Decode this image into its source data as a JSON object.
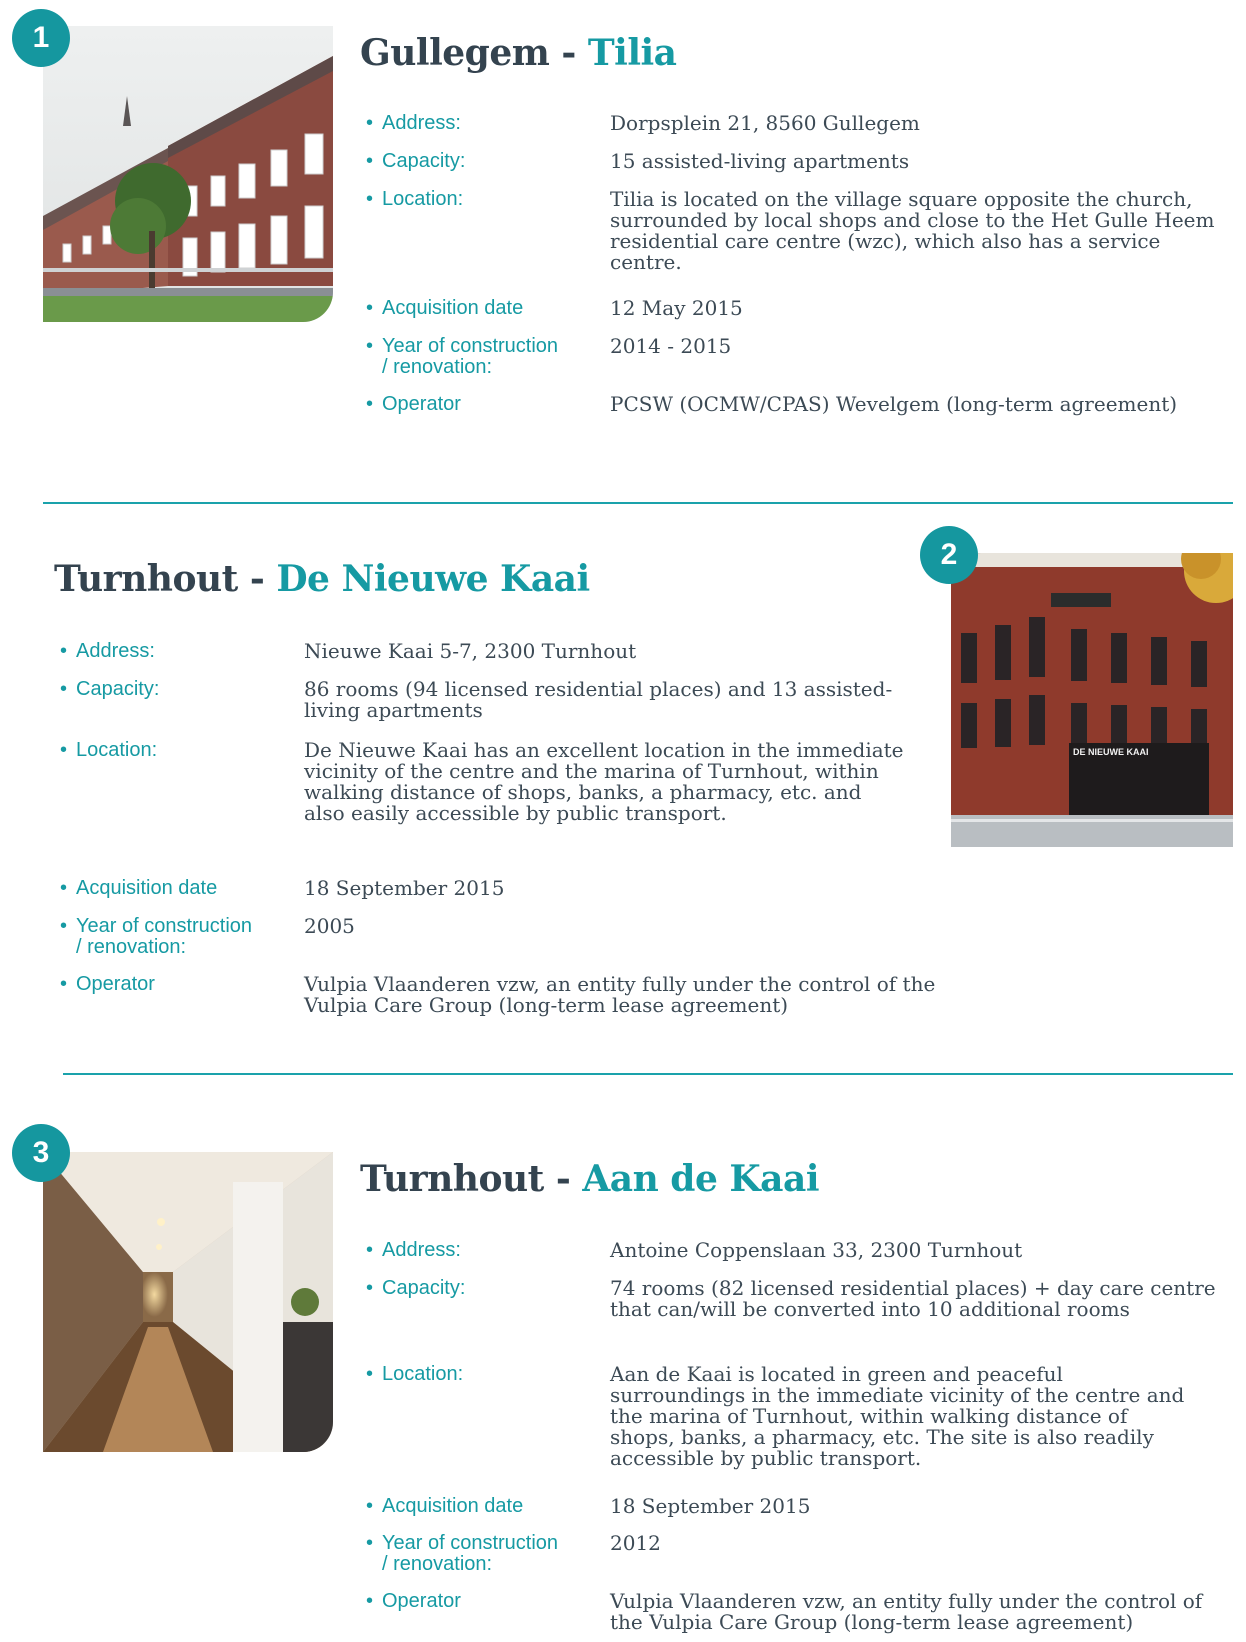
{
  "sections": [
    {
      "number": "1",
      "city": "Gullegem",
      "separator": " - ",
      "name": "Tilia",
      "photo": "building-photo",
      "rows": [
        {
          "label": "Address:",
          "value": "Dorpsplein 21, 8560 Gullegem"
        },
        {
          "label": "Capacity:",
          "value": "15 assisted-living apartments"
        },
        {
          "label": "Location:",
          "value": "Tilia is located on the village square opposite the church, surrounded by local shops and close to the Het Gulle Heem residential care centre (wzc), which also has a service centre."
        },
        {
          "label": "Acquisition date",
          "value": "12 May 2015"
        },
        {
          "label": "Year of construction",
          "label_cont": "/ renovation:",
          "value": "2014 - 2015"
        },
        {
          "label": "Operator",
          "value": "PCSW (OCMW/CPAS) Wevelgem (long-term agreement)"
        }
      ]
    },
    {
      "number": "2",
      "city": "Turnhout",
      "separator": " - ",
      "name": "De Nieuwe Kaai",
      "photo": "building-photo",
      "sign_text": "DE NIEUWE KAAI",
      "rows": [
        {
          "label": "Address:",
          "value": "Nieuwe Kaai 5-7, 2300 Turnhout"
        },
        {
          "label": "Capacity:",
          "value": "86 rooms (94 licensed residential places) and 13 assisted-living apartments"
        },
        {
          "label": "Location:",
          "value": "De Nieuwe Kaai has an excellent location in the immediate vicinity of the centre and the marina of Turnhout, within walking distance of shops, banks, a pharmacy, etc. and also easily accessible by public transport."
        },
        {
          "label": "Acquisition date",
          "value": "18 September 2015"
        },
        {
          "label": "Year of construction",
          "label_cont": "/ renovation:",
          "value": "2005"
        },
        {
          "label": "Operator",
          "value": "Vulpia Vlaanderen vzw, an entity fully under the control of the Vulpia Care Group (long-term lease agreement)"
        }
      ]
    },
    {
      "number": "3",
      "city": "Turnhout",
      "separator": " - ",
      "name": "Aan de Kaai",
      "photo": "corridor-photo",
      "rows": [
        {
          "label": "Address:",
          "value": "Antoine Coppenslaan 33, 2300 Turnhout"
        },
        {
          "label": "Capacity:",
          "value": "74 rooms (82 licensed residential places) + day care centre that can/will be converted into 10 additional rooms"
        },
        {
          "label": "Location:",
          "value": "Aan de Kaai is located in green and peaceful surroundings in the immediate vicinity of the centre and the marina of Turnhout, within walking distance of shops, banks, a pharmacy, etc. The site is also readily accessible by public transport."
        },
        {
          "label": "Acquisition date",
          "value": "18 September 2015"
        },
        {
          "label": "Year of construction",
          "label_cont": "/ renovation:",
          "value": "2012"
        },
        {
          "label": "Operator",
          "value": "Vulpia Vlaanderen vzw, an entity fully under the control of the Vulpia Care Group (long-term lease agreement)"
        }
      ]
    }
  ],
  "colors": {
    "accent": "#169aa3",
    "title": "#34434f",
    "text": "#3c4a55",
    "badge": "#15979f"
  }
}
